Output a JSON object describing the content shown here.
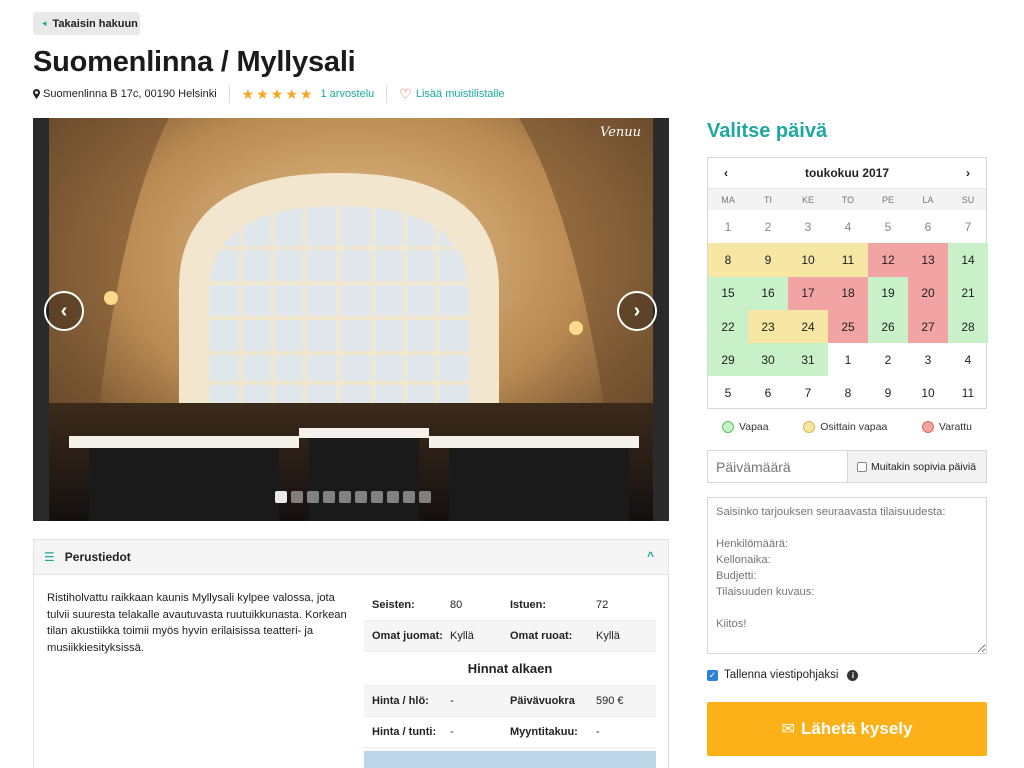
{
  "back": {
    "label": "Takaisin hakuun"
  },
  "venue": {
    "title": "Suomenlinna / Myllysali",
    "address": "Suomenlinna B 17c, 00190 Helsinki",
    "rating": 5,
    "reviews": "1 arvostelu",
    "wishlist": "Lisää muistilistalle"
  },
  "gallery": {
    "logo": "Venuu",
    "slide_count": 10,
    "active_slide": 1
  },
  "panel": {
    "title": "Perustiedot",
    "description": "Ristiholvattu raikkaan kaunis Myllysali kylpee valossa, jota tulvii suuresta telakalle avautuvasta ruutuikkunasta. Korkean tilan akustiikka toimii myös hyvin erilaisissa teatteri- ja musiikkiesityksissä.",
    "facts": {
      "standing_label": "Seisten:",
      "standing": "80",
      "seated_label": "Istuen:",
      "seated": "72",
      "own_drinks_label": "Omat juomat:",
      "own_drinks": "Kyllä",
      "own_food_label": "Omat ruoat:",
      "own_food": "Kyllä",
      "prices_heading": "Hinnat alkaen",
      "price_person_label": "Hinta / hlö:",
      "price_person": "-",
      "day_rent_label": "Päivävuokra",
      "day_rent": "590 €",
      "price_hour_label": "Hinta / tunti:",
      "price_hour": "-",
      "sales_margin_label": "Myyntitakuu:",
      "sales_margin": "-"
    }
  },
  "calendar": {
    "heading": "Valitse päivä",
    "month": "toukokuu 2017",
    "prev": "‹",
    "next": "›",
    "weekdays": [
      "MA",
      "TI",
      "KE",
      "TO",
      "PE",
      "LA",
      "SU"
    ],
    "cells": [
      {
        "d": "1",
        "s": "dim"
      },
      {
        "d": "2",
        "s": "dim"
      },
      {
        "d": "3",
        "s": "dim"
      },
      {
        "d": "4",
        "s": "dim"
      },
      {
        "d": "5",
        "s": "dim"
      },
      {
        "d": "6",
        "s": "dim"
      },
      {
        "d": "7",
        "s": "dim"
      },
      {
        "d": "8",
        "s": "partial"
      },
      {
        "d": "9",
        "s": "partial"
      },
      {
        "d": "10",
        "s": "partial"
      },
      {
        "d": "11",
        "s": "partial"
      },
      {
        "d": "12",
        "s": "booked"
      },
      {
        "d": "13",
        "s": "booked"
      },
      {
        "d": "14",
        "s": "free"
      },
      {
        "d": "15",
        "s": "free"
      },
      {
        "d": "16",
        "s": "free"
      },
      {
        "d": "17",
        "s": "booked"
      },
      {
        "d": "18",
        "s": "booked"
      },
      {
        "d": "19",
        "s": "free"
      },
      {
        "d": "20",
        "s": "booked"
      },
      {
        "d": "21",
        "s": "free"
      },
      {
        "d": "22",
        "s": "free"
      },
      {
        "d": "23",
        "s": "partial"
      },
      {
        "d": "24",
        "s": "partial"
      },
      {
        "d": "25",
        "s": "booked"
      },
      {
        "d": "26",
        "s": "free"
      },
      {
        "d": "27",
        "s": "booked"
      },
      {
        "d": "28",
        "s": "free"
      },
      {
        "d": "29",
        "s": "free"
      },
      {
        "d": "30",
        "s": "free"
      },
      {
        "d": "31",
        "s": "free"
      },
      {
        "d": "1",
        "s": "next"
      },
      {
        "d": "2",
        "s": "next"
      },
      {
        "d": "3",
        "s": "next"
      },
      {
        "d": "4",
        "s": "next"
      },
      {
        "d": "5",
        "s": "next"
      },
      {
        "d": "6",
        "s": "next"
      },
      {
        "d": "7",
        "s": "next"
      },
      {
        "d": "8",
        "s": "next"
      },
      {
        "d": "9",
        "s": "next"
      },
      {
        "d": "10",
        "s": "next"
      },
      {
        "d": "11",
        "s": "next"
      }
    ],
    "legend": {
      "free": "Vapaa",
      "partial": "Osittain vapaa",
      "booked": "Varattu"
    },
    "colors": {
      "free": "#c9f1c9",
      "partial": "#f7e7a4",
      "booked": "#f2a3a3"
    }
  },
  "form": {
    "date_placeholder": "Päivämäärä",
    "other_days": "Muitakin sopivia päiviä",
    "message_placeholder": "Saisinko tarjouksen seuraavasta tilaisuudesta:\n\nHenkilömäärä:\nKellonaika:\nBudjetti:\nTilaisuuden kuvaus:\n\nKiitos!",
    "save_template": "Tallenna viestipohjaksi",
    "save_template_checked": true,
    "send": "Lähetä kysely"
  },
  "colors": {
    "accent": "#1ea9a0",
    "send": "#fbb117",
    "star": "#f5a623"
  }
}
